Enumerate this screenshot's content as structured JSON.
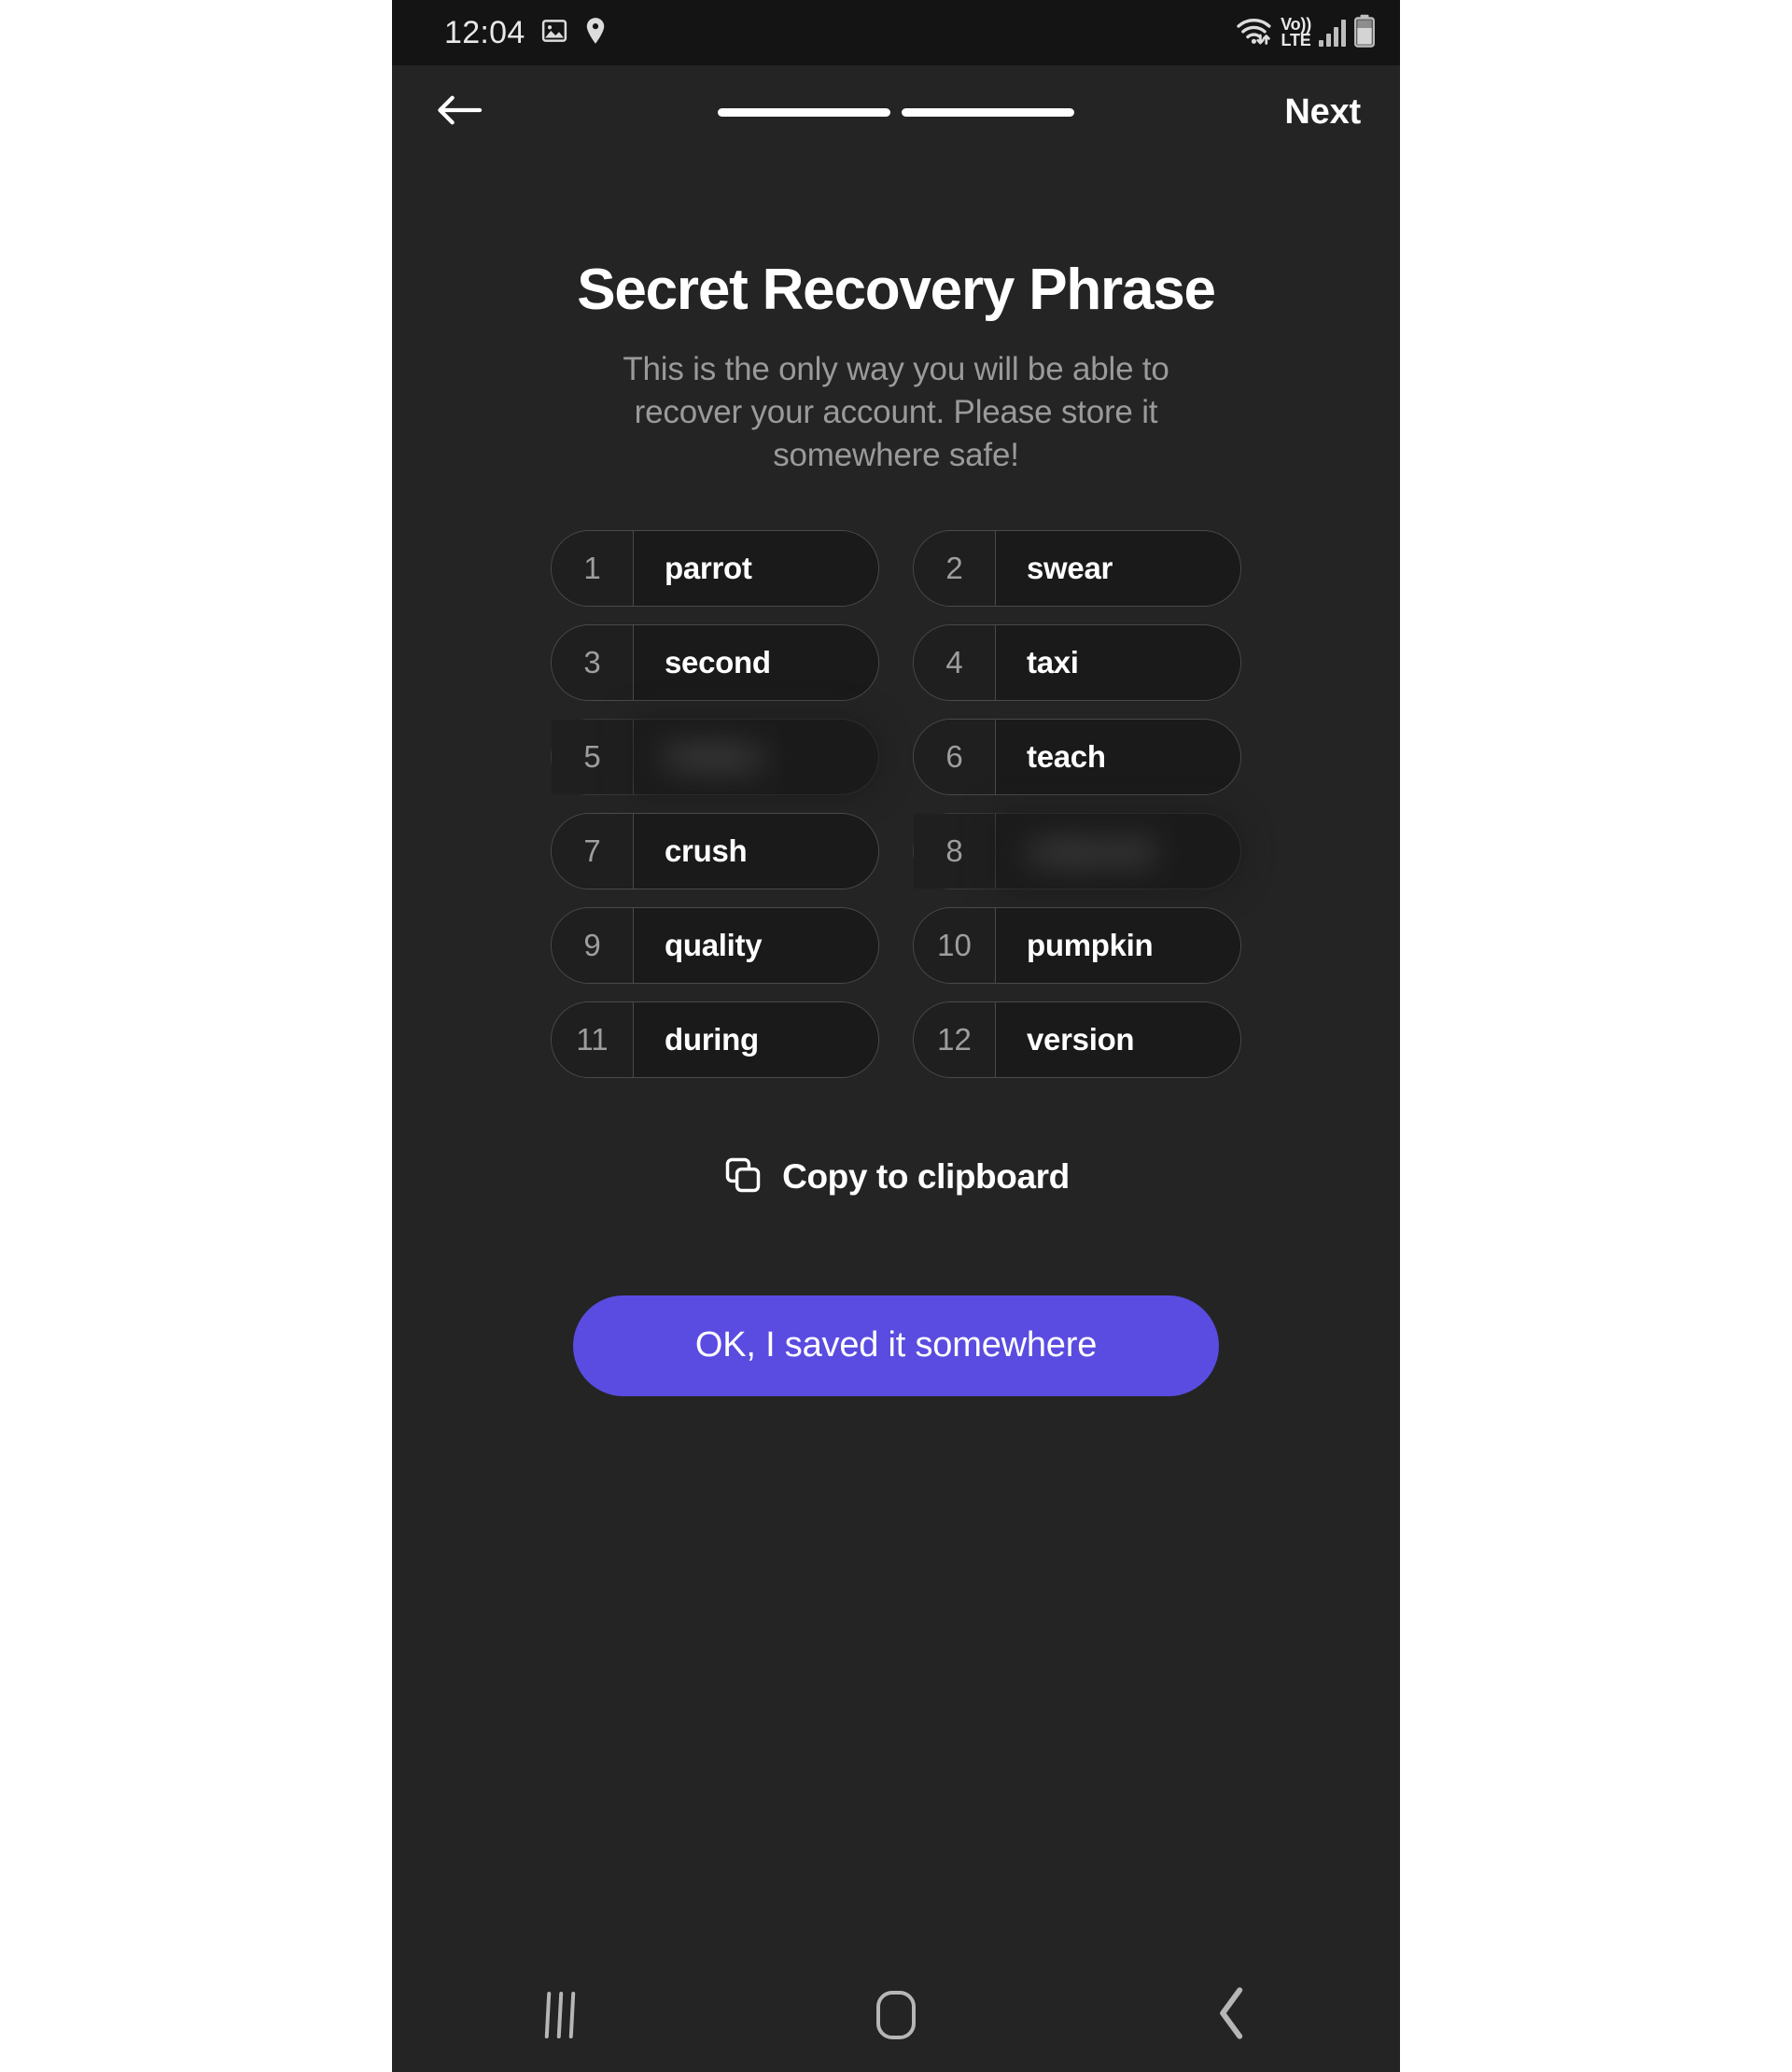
{
  "statusbar": {
    "time": "12:04",
    "icons_left": [
      "image-icon",
      "location-pin-icon"
    ],
    "icons_right": [
      "wifi-icon",
      "volte-icon",
      "signal-bars-icon",
      "battery-icon"
    ],
    "volte_top": "Vo))",
    "volte_bottom": "LTE"
  },
  "topnav": {
    "back_icon": "arrow-left-icon",
    "next_label": "Next",
    "progress_segments": 2,
    "progress_filled": 2
  },
  "page": {
    "title": "Secret Recovery Phrase",
    "subtitle": "This is the only way you will be able to recover your account. Please store it somewhere safe!"
  },
  "words": [
    {
      "num": "1",
      "word": "parrot",
      "hidden": false
    },
    {
      "num": "2",
      "word": "swear",
      "hidden": false
    },
    {
      "num": "3",
      "word": "second",
      "hidden": false
    },
    {
      "num": "4",
      "word": "taxi",
      "hidden": false
    },
    {
      "num": "5",
      "word": "hidden",
      "hidden": true
    },
    {
      "num": "6",
      "word": "teach",
      "hidden": false
    },
    {
      "num": "7",
      "word": "crush",
      "hidden": false
    },
    {
      "num": "8",
      "word": "redacted",
      "hidden": true
    },
    {
      "num": "9",
      "word": "quality",
      "hidden": false
    },
    {
      "num": "10",
      "word": "pumpkin",
      "hidden": false
    },
    {
      "num": "11",
      "word": "during",
      "hidden": false
    },
    {
      "num": "12",
      "word": "version",
      "hidden": false
    }
  ],
  "copy": {
    "icon": "copy-icon",
    "label": "Copy to clipboard"
  },
  "cta": {
    "label": "OK, I saved it somewhere",
    "color": "#5a4ce0"
  },
  "androidnav": {
    "recents": "recents-icon",
    "home": "home-icon",
    "back": "back-chevron-icon"
  },
  "colors": {
    "screen_bg": "#242424",
    "statusbar_bg": "#141414",
    "pill_bg": "#1a1a1a",
    "pill_border": "#4a4a4a",
    "accent": "#5a4ce0",
    "text_primary": "#ffffff",
    "text_secondary": "#9a9a9a"
  }
}
